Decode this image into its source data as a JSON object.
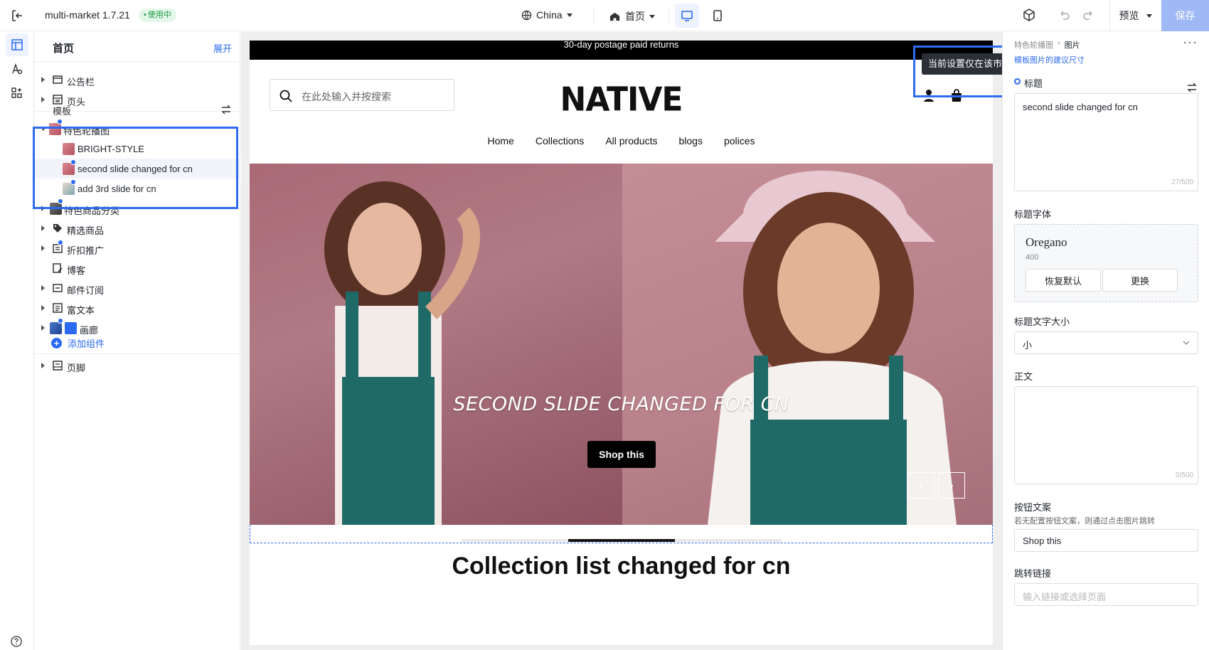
{
  "topbar": {
    "app_title": "multi-market 1.7.21",
    "status_badge": "使用中",
    "market": "China",
    "page": "首页",
    "preview_label": "预览",
    "save_label": "保存"
  },
  "tree": {
    "title": "首页",
    "expand_label": "展开",
    "header_items": [
      {
        "label": "公告栏"
      },
      {
        "label": "页头"
      }
    ],
    "template_label": "模板",
    "sections": [
      {
        "label": "特色轮播图"
      },
      {
        "label": "BRIGHT-STYLE"
      },
      {
        "label": "second slide changed for cn"
      },
      {
        "label": "add 3rd slide for cn"
      },
      {
        "label": "特色商品分类"
      },
      {
        "label": "精选商品"
      },
      {
        "label": "折扣推广"
      },
      {
        "label": "博客"
      },
      {
        "label": "邮件订阅"
      },
      {
        "label": "富文本"
      },
      {
        "label": "画廊"
      }
    ],
    "add_component_label": "添加组件",
    "footer_label": "页脚"
  },
  "site": {
    "announcement": "30-day postage paid returns",
    "search_placeholder": "在此处输入并按搜索",
    "logo": "NATIVE",
    "nav": [
      "Home",
      "Collections",
      "All products",
      "blogs",
      "polices"
    ],
    "hero_title": "SECOND SLIDE CHANGED FOR CN",
    "hero_button": "Shop this",
    "collection_title": "Collection list changed for cn"
  },
  "tooltip": "当前设置仅在该市场生效",
  "right_panel": {
    "breadcrumb_parent": "特色轮播图",
    "breadcrumb_current": "图片",
    "link_text": "模板图片的建议尺寸",
    "title_label": "标题",
    "title_value": "second slide changed for cn",
    "title_count": "27/500",
    "title_font_label": "标题字体",
    "font_name": "Oregano",
    "font_weight": "400",
    "reset_label": "恢复默认",
    "change_label": "更换",
    "title_size_label": "标题文字大小",
    "title_size_value": "小",
    "body_label": "正文",
    "body_count": "0/500",
    "button_text_label": "按钮文案",
    "button_text_hint": "若无配置按钮文案，则通过点击图片跳转",
    "button_text_value": "Shop this",
    "link_label": "跳转链接",
    "link_placeholder": "输入链接或选择页面"
  },
  "colors": {
    "accent": "#2a6af2",
    "save_button": "#9fb8f6",
    "highlight": "#2f6bf0"
  }
}
